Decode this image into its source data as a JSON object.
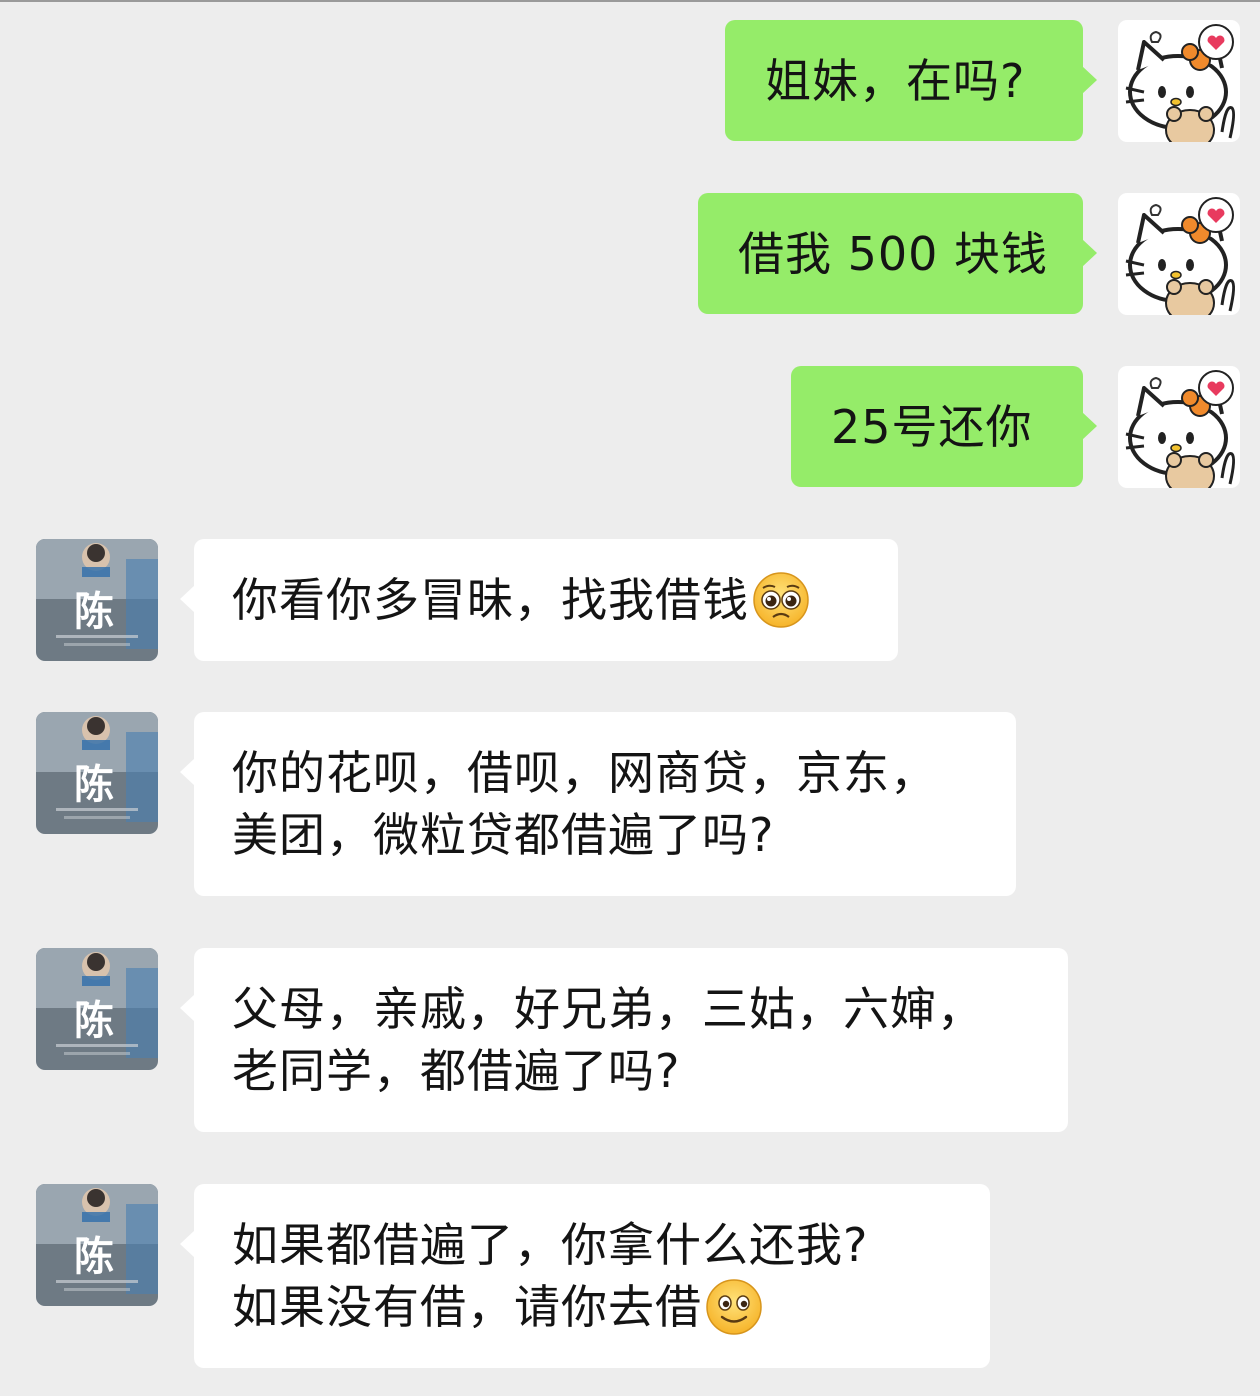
{
  "chat": {
    "sent": [
      {
        "text": "姐妹，在吗?"
      },
      {
        "text": "借我 500 块钱"
      },
      {
        "text": "25号还你"
      }
    ],
    "received": [
      {
        "lines": [
          "你看你多冒昧，找我借钱"
        ],
        "emoji": "pleading-face"
      },
      {
        "lines": [
          "你的花呗，借呗，网商贷，京东，",
          "美团，微粒贷都借遍了吗?"
        ]
      },
      {
        "lines": [
          "父母，亲戚，好兄弟，三姑，六婶，",
          "老同学，都借遍了吗?"
        ]
      },
      {
        "lines": [
          "如果都借遍了，你拿什么还我?",
          "如果没有借，请你去借"
        ],
        "emoji": "smiling-face"
      }
    ],
    "avatars": {
      "self": "hello-kitty-avatar",
      "other_char": "陈"
    }
  },
  "colors": {
    "background": "#ededed",
    "sent_bubble": "#95ec69",
    "received_bubble": "#ffffff"
  }
}
